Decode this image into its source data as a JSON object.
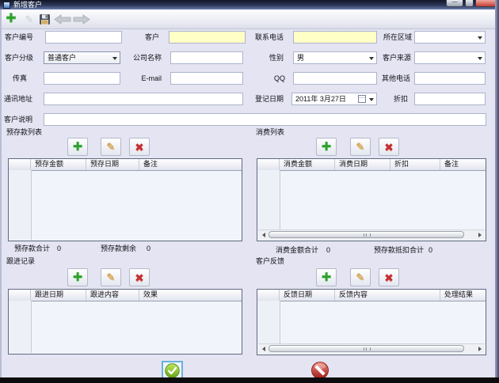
{
  "window": {
    "title": "新增客户",
    "controls": {
      "minimize": "—",
      "maximize": "",
      "close": "r"
    }
  },
  "toolbar": {
    "icons": [
      "add-icon",
      "edit-icon",
      "save-icon",
      "back-icon",
      "forward-icon"
    ],
    "add_glyph": "✚",
    "edit_glyph": "✎"
  },
  "form": {
    "customer_id_label": "客户编号",
    "customer_label": "客户",
    "contact_phone_label": "联系电话",
    "region_label": "所在区域",
    "level_label": "客户分级",
    "level_value": "普通客户",
    "company_label": "公司名称",
    "gender_label": "性别",
    "gender_value": "男",
    "source_label": "客户来源",
    "fax_label": "传真",
    "email_label": "E-mail",
    "qq_label": "QQ",
    "other_phone_label": "其他电话",
    "address_label": "通讯地址",
    "date_label": "登记日期",
    "date_value": "2011年 3月27日",
    "discount_label": "折扣",
    "note_label": "客户说明",
    "accent_required_field_color": "#ffffc6"
  },
  "panel_buttons": {
    "add_glyph": "✚",
    "edit_glyph": "✎",
    "delete_glyph": "✖"
  },
  "panels": {
    "deposit": {
      "title": "预存款列表",
      "columns": [
        "预存金额",
        "预存日期",
        "备注"
      ],
      "total1_label": "预存款合计",
      "total1_value": "0",
      "total2_label": "预存款剩余",
      "total2_value": "0"
    },
    "consume": {
      "title": "消费列表",
      "columns": [
        "消费金额",
        "消费日期",
        "折扣",
        "备注"
      ],
      "total1_label": "消费金额合计",
      "total1_value": "0",
      "total2_label": "预存款抵扣合计",
      "total2_value": "0"
    },
    "follow": {
      "title": "跟进记录",
      "columns": [
        "跟进日期",
        "跟进内容",
        "效果"
      ]
    },
    "feedback": {
      "title": "客户反馈",
      "columns": [
        "反馈日期",
        "反馈内容",
        "处理结果"
      ]
    }
  },
  "colors": {
    "ok_green": "#6fb322",
    "cancel_red": "#c22f2a",
    "titlebar": "#2b3658"
  }
}
